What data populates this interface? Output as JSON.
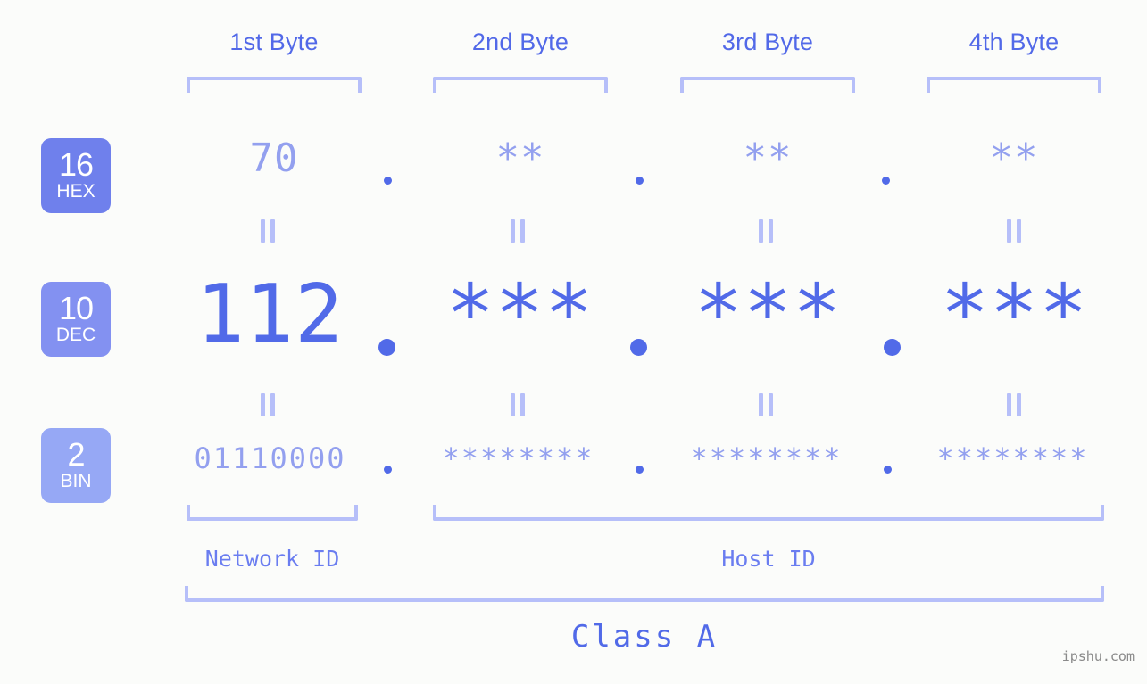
{
  "watermark": "ipshu.com",
  "columns": [
    {
      "label": "1st Byte"
    },
    {
      "label": "2nd Byte"
    },
    {
      "label": "3rd Byte"
    },
    {
      "label": "4th Byte"
    }
  ],
  "rows": [
    {
      "base": "16",
      "base_name": "HEX",
      "badge_color": "#6f80ec",
      "values": [
        "70",
        "**",
        "**",
        "**"
      ]
    },
    {
      "base": "10",
      "base_name": "DEC",
      "badge_color": "#8391f1",
      "values": [
        "112",
        "***",
        "***",
        "***"
      ]
    },
    {
      "base": "2",
      "base_name": "BIN",
      "badge_color": "#96a8f5",
      "values": [
        "01110000",
        "********",
        "********",
        "********"
      ]
    }
  ],
  "separator": ".",
  "equality_symbol": "=",
  "segments": {
    "network_id": "Network ID",
    "host_id": "Host ID"
  },
  "class_label": "Class A",
  "colors": {
    "background": "#fbfcfa",
    "accent_strong": "#516ae8",
    "accent_light": "#93a0ef",
    "bracket": "#b6bff9",
    "header_text": "#5269e8",
    "watermark": "#8a8a8a"
  }
}
